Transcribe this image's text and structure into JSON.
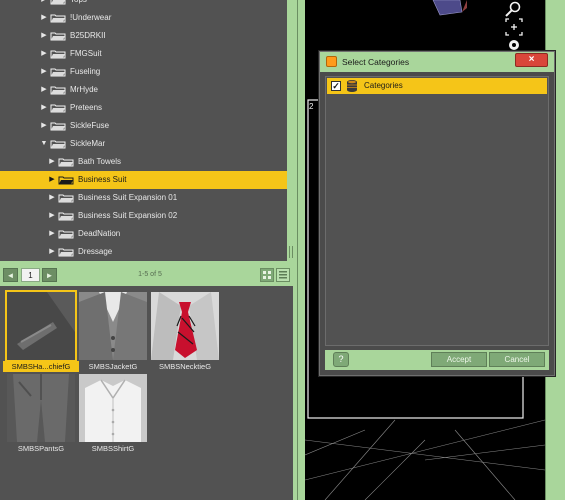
{
  "content_library": {
    "tree_items": [
      {
        "label": "Tops",
        "expanded": false,
        "selected": false
      },
      {
        "label": "!Underwear",
        "expanded": false,
        "selected": false
      },
      {
        "label": "B25DRKII",
        "expanded": false,
        "selected": false
      },
      {
        "label": "FMGSuit",
        "expanded": false,
        "selected": false
      },
      {
        "label": "Fuseling",
        "expanded": false,
        "selected": false
      },
      {
        "label": "MrHyde",
        "expanded": false,
        "selected": false
      },
      {
        "label": "Preteens",
        "expanded": false,
        "selected": false
      },
      {
        "label": "SickleFuse",
        "expanded": false,
        "selected": false
      },
      {
        "label": "SickleMar",
        "expanded": true,
        "selected": false
      },
      {
        "label": "Bath Towels",
        "expanded": false,
        "selected": false
      },
      {
        "label": "Business Suit",
        "expanded": false,
        "selected": true
      },
      {
        "label": "Business Suit Expansion 01",
        "expanded": false,
        "selected": false
      },
      {
        "label": "Business Suit Expansion 02",
        "expanded": false,
        "selected": false
      },
      {
        "label": "DeadNation",
        "expanded": false,
        "selected": false
      },
      {
        "label": "Dressage",
        "expanded": false,
        "selected": false
      }
    ],
    "pager": {
      "prev_icon": "arrow-left-icon",
      "next_icon": "arrow-right-icon",
      "page": "1",
      "range": "1-5 of 5"
    },
    "thumbnails": [
      {
        "label": "SMBSHa...chiefG",
        "selected": true,
        "image": "handkerchief-pocket"
      },
      {
        "label": "SMBSJacketG",
        "selected": false,
        "image": "jacket"
      },
      {
        "label": "SMBSNecktieG",
        "selected": false,
        "image": "necktie"
      },
      {
        "label": "SMBSPantsG",
        "selected": false,
        "image": "pants"
      },
      {
        "label": "SMBSShirtG",
        "selected": false,
        "image": "shirt"
      }
    ]
  },
  "viewport_tools": [
    "camera-cube-icon",
    "zoom-icon",
    "frame-icon",
    "orbit-icon"
  ],
  "dialog": {
    "title": "Select Categories",
    "close_symbol": "×",
    "category": {
      "label": "Categories",
      "checked": true,
      "check_mark": "✓"
    },
    "help_symbol": "?",
    "accept_label": "Accept",
    "cancel_label": "Cancel"
  },
  "colors": {
    "accent_highlight": "#f5c518",
    "chrome_green": "#a9d69b",
    "panel_gray": "#525252",
    "close_red": "#d9463a"
  }
}
